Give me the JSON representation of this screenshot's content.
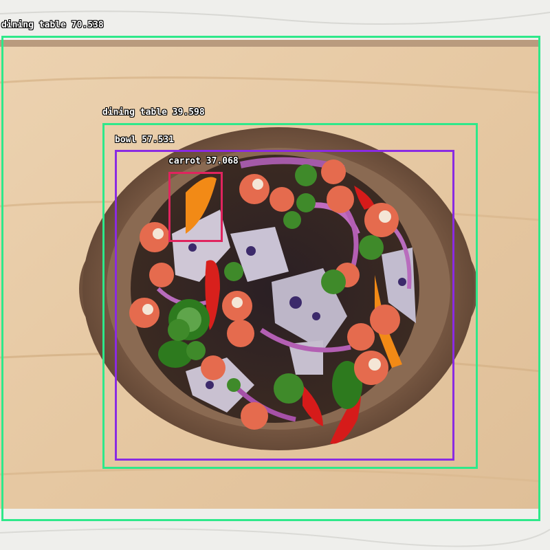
{
  "detections": [
    {
      "label": "dining table",
      "score": "70.538",
      "color": "#2ee88a"
    },
    {
      "label": "dining table",
      "score": "39.598",
      "color": "#2ee88a"
    },
    {
      "label": "bowl",
      "score": "57.531",
      "color": "#8a2be2"
    },
    {
      "label": "carrot",
      "score": "37.068",
      "color": "#e0245e"
    }
  ]
}
